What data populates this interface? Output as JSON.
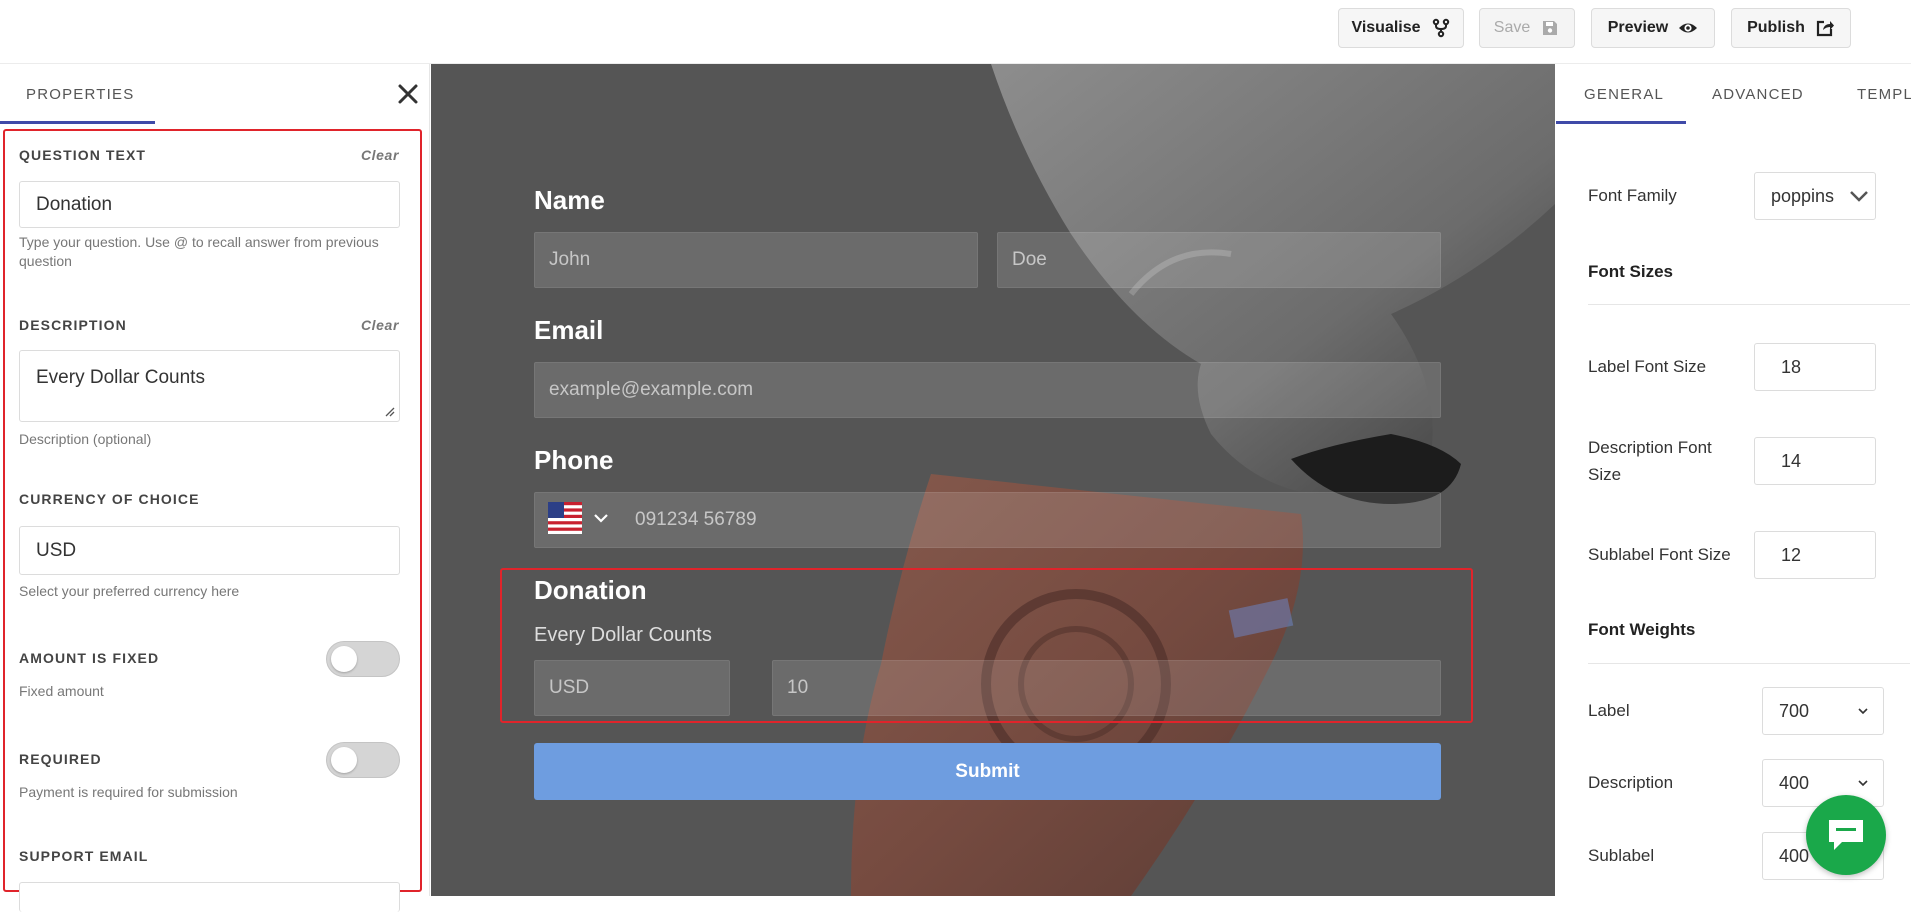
{
  "toolbar": {
    "visualise_label": "Visualise",
    "save_label": "Save",
    "preview_label": "Preview",
    "publish_label": "Publish"
  },
  "properties": {
    "tab_label": "PROPERTIES",
    "question_text": {
      "label": "QUESTION TEXT",
      "clear": "Clear",
      "value": "Donation",
      "help": "Type your question. Use @ to recall answer from previous question"
    },
    "description": {
      "label": "DESCRIPTION",
      "clear": "Clear",
      "value": "Every Dollar Counts",
      "help": "Description (optional)"
    },
    "currency": {
      "label": "CURRENCY OF CHOICE",
      "value": "USD",
      "help": "Select your preferred currency here"
    },
    "amount_fixed": {
      "label": "AMOUNT IS FIXED",
      "help": "Fixed amount",
      "enabled": false
    },
    "required": {
      "label": "REQUIRED",
      "help": "Payment is required for submission",
      "enabled": false
    },
    "support_email": {
      "label": "SUPPORT EMAIL"
    }
  },
  "form": {
    "name_label": "Name",
    "first_name_placeholder": "John",
    "last_name_placeholder": "Doe",
    "email_label": "Email",
    "email_placeholder": "example@example.com",
    "phone_label": "Phone",
    "phone_placeholder": "091234 56789",
    "donation_label": "Donation",
    "donation_description": "Every Dollar Counts",
    "currency_value": "USD",
    "amount_value": "10",
    "submit_label": "Submit"
  },
  "design": {
    "tabs": [
      "GENERAL",
      "ADVANCED",
      "TEMPL"
    ],
    "font_family_label": "Font Family",
    "font_family_value": "poppins",
    "font_sizes_heading": "Font Sizes",
    "label_font_size_label": "Label Font Size",
    "label_font_size": "18",
    "description_font_size_label": "Description Font Size",
    "description_font_size": "14",
    "sublabel_font_size_label": "Sublabel Font Size",
    "sublabel_font_size": "12",
    "font_weights_heading": "Font Weights",
    "label_weight_label": "Label",
    "label_weight": "700",
    "description_weight_label": "Description",
    "description_weight": "400",
    "sublabel_weight_label": "Sublabel",
    "sublabel_weight": "400"
  },
  "colors": {
    "accent": "#3f4aa8",
    "highlight": "#e0242b",
    "submit": "#6e9de0",
    "chat": "#1aa84a"
  }
}
